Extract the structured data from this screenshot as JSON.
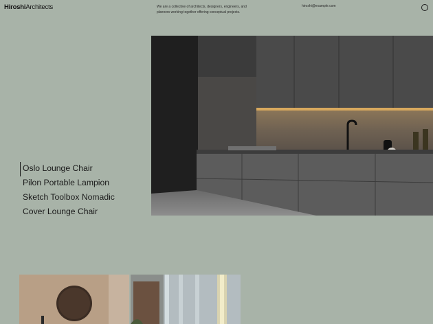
{
  "header": {
    "logo_bold": "Hiroshi",
    "logo_light": "Architects",
    "tagline": "We are a collective of architects, designers, engineers, and planners working together offering conceptual projects.",
    "email": "hiroshi@example.com",
    "menu_icon": "circle-icon"
  },
  "hero_image": {
    "subject": "dark grey kitchen interior"
  },
  "products": [
    {
      "label": "Oslo Lounge Chair",
      "active": true
    },
    {
      "label": "Pilon Portable Lampion",
      "active": false
    },
    {
      "label": "Sketch Toolbox Nomadic",
      "active": false
    },
    {
      "label": "Cover Lounge Chair",
      "active": false
    }
  ],
  "colors": {
    "background": "#a8b3a8",
    "text": "#141414"
  }
}
